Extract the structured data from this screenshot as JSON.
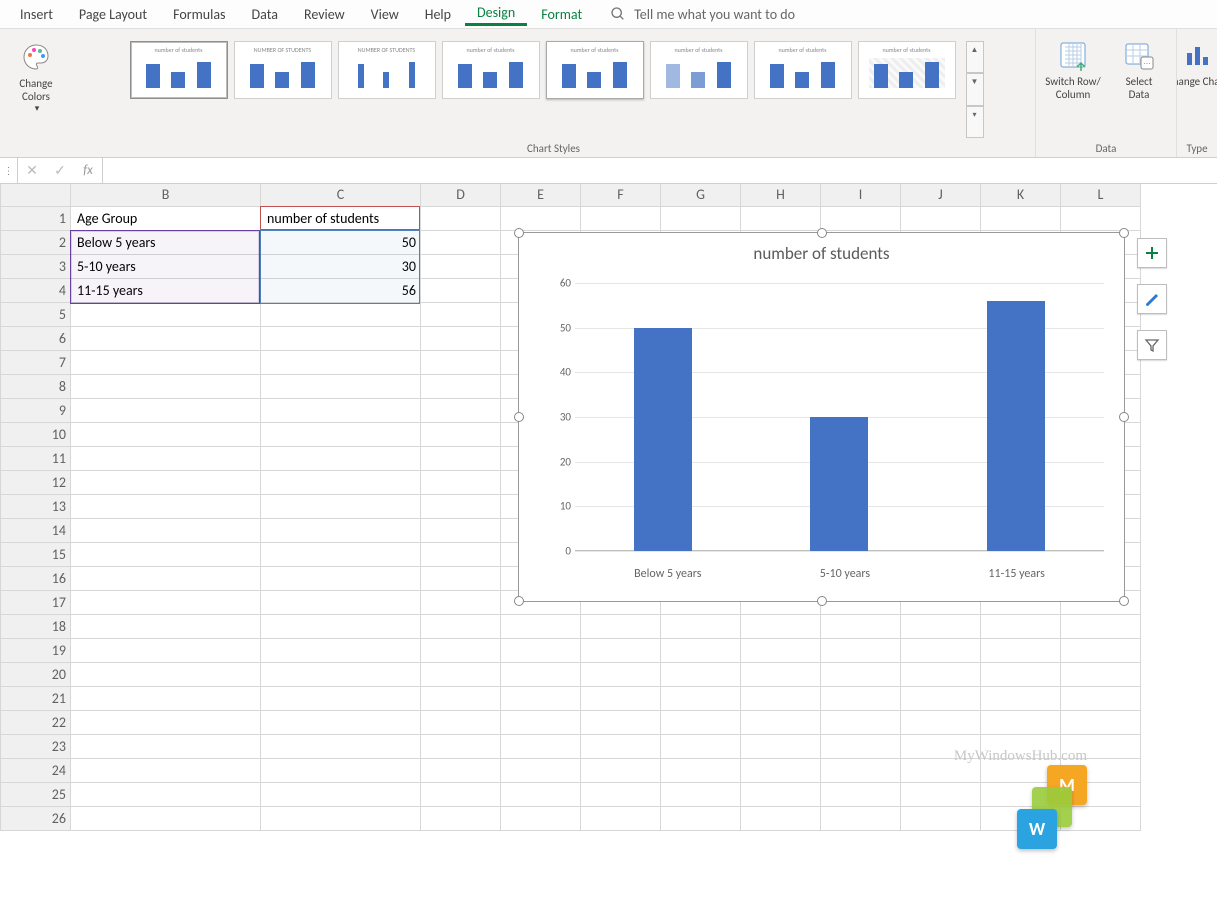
{
  "tabs": [
    "Insert",
    "Page Layout",
    "Formulas",
    "Data",
    "Review",
    "View",
    "Help",
    "Design",
    "Format"
  ],
  "active_tab": "Design",
  "tell_me_placeholder": "Tell me what you want to do",
  "ribbon": {
    "change_colors": "Change\nColors",
    "chart_styles_label": "Chart Styles",
    "switch_label": "Switch Row/\nColumn",
    "select_data_label": "Select\nData",
    "data_label": "Data",
    "change_chart": "Change Chart",
    "type_label": "Type"
  },
  "formula_bar": {
    "cancel": "✕",
    "enter": "✓",
    "fx": "fx"
  },
  "columns": [
    "B",
    "C",
    "D",
    "E",
    "F",
    "G",
    "H",
    "I",
    "J",
    "K",
    "L"
  ],
  "row_numbers": [
    1,
    2,
    3,
    4,
    5,
    6,
    7,
    8,
    9,
    10,
    11,
    12,
    13,
    14,
    15,
    16,
    17,
    18,
    19,
    20,
    21,
    22,
    23,
    24,
    25,
    26
  ],
  "cells": {
    "B1": "Age Group",
    "C1": "number of students",
    "B2": "Below 5 years",
    "B3": "5-10 years",
    "B4": "11-15 years",
    "C2": "50",
    "C3": "30",
    "C4": "56"
  },
  "chart_title": "number of students",
  "chart_data": {
    "type": "bar",
    "title": "number of students",
    "categories": [
      "Below 5 years",
      "5-10 years",
      "11-15 years"
    ],
    "values": [
      50,
      30,
      56
    ],
    "ylim": [
      0,
      60
    ],
    "y_ticks": [
      0,
      10,
      20,
      30,
      40,
      50,
      60
    ],
    "xlabel": "",
    "ylabel": ""
  },
  "watermark": "MyWindowsHub.com",
  "logo_letters": {
    "top": "M",
    "bottom": "W"
  }
}
